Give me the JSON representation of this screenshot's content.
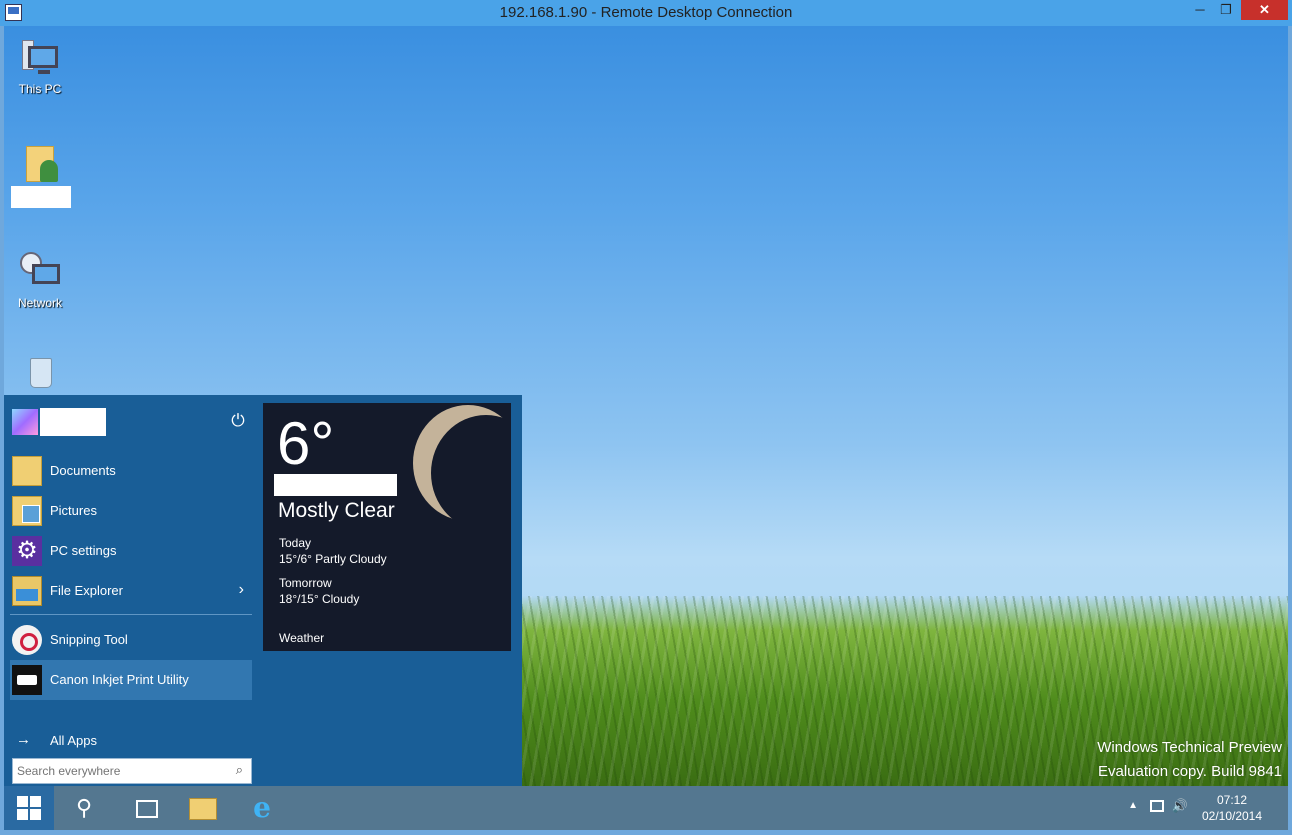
{
  "window": {
    "title": "192.168.1.90 - Remote Desktop Connection",
    "min_glyph": "─",
    "restore_glyph": "❐",
    "close_glyph": "✕"
  },
  "desktop": {
    "icons": [
      {
        "name": "this-pc",
        "label": "This PC"
      },
      {
        "name": "user-folder",
        "label": ""
      },
      {
        "name": "network",
        "label": "Network"
      },
      {
        "name": "recycle-bin",
        "label": ""
      }
    ],
    "watermark_line1": "Windows Technical Preview",
    "watermark_line2": "Evaluation copy. Build 9841"
  },
  "start_menu": {
    "power_glyph": "⏻",
    "items": [
      {
        "label": "Documents",
        "icon": "folder-icon"
      },
      {
        "label": "Pictures",
        "icon": "pictures-icon"
      },
      {
        "label": "PC settings",
        "icon": "gear-icon"
      },
      {
        "label": "File Explorer",
        "icon": "file-explorer-icon",
        "chevron": "›"
      },
      {
        "label": "Snipping Tool",
        "icon": "snipping-tool-icon"
      },
      {
        "label": "Canon Inkjet Print Utility",
        "icon": "printer-icon"
      }
    ],
    "all_apps_label": "All Apps",
    "all_apps_arrow": "→",
    "search_placeholder": "Search everywhere",
    "search_glyph": "⌕"
  },
  "weather": {
    "temperature": "6°",
    "condition": "Mostly Clear",
    "forecast": [
      {
        "day": "Today",
        "detail": "15°/6° Partly Cloudy"
      },
      {
        "day": "Tomorrow",
        "detail": "18°/15° Cloudy"
      }
    ],
    "tile_label": "Weather"
  },
  "taskbar": {
    "search_glyph": "⚲",
    "ie_glyph": "e",
    "tray_chevron": "▲",
    "volume_glyph": "🔊",
    "time": "07:12",
    "date": "02/10/2014"
  }
}
